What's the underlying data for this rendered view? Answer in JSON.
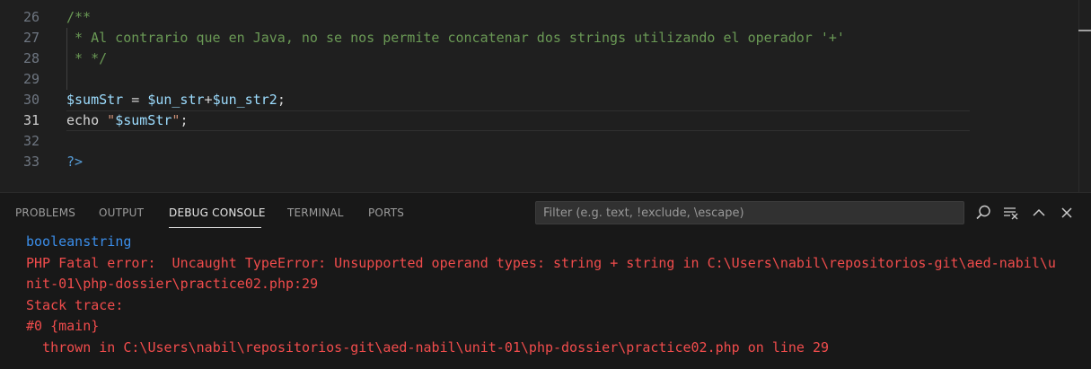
{
  "editor": {
    "lines": [
      {
        "num": "26",
        "tokens": [
          {
            "t": "/**",
            "c": "tk-comment"
          }
        ]
      },
      {
        "num": "27",
        "tokens": [
          {
            "t": " * Al contrario que en Java, no se nos permite concatenar dos strings utilizando el operador '+'",
            "c": "tk-comment"
          }
        ]
      },
      {
        "num": "28",
        "tokens": [
          {
            "t": " * */",
            "c": "tk-comment"
          }
        ]
      },
      {
        "num": "29",
        "tokens": []
      },
      {
        "num": "30",
        "tokens": [
          {
            "t": "$sumStr",
            "c": "tk-var"
          },
          {
            "t": " = ",
            "c": "tk-op"
          },
          {
            "t": "$un_str",
            "c": "tk-var"
          },
          {
            "t": "+",
            "c": "tk-op"
          },
          {
            "t": "$un_str2",
            "c": "tk-var"
          },
          {
            "t": ";",
            "c": "tk-op"
          }
        ]
      },
      {
        "num": "31",
        "active": true,
        "tokens": [
          {
            "t": "echo ",
            "c": "tk-kw"
          },
          {
            "t": "\"",
            "c": "tk-str"
          },
          {
            "t": "$sumStr",
            "c": "tk-var"
          },
          {
            "t": "\"",
            "c": "tk-str"
          },
          {
            "t": ";",
            "c": "tk-op"
          }
        ]
      },
      {
        "num": "32",
        "tokens": []
      },
      {
        "num": "33",
        "tokens": [
          {
            "t": "?>",
            "c": "tk-tag"
          }
        ]
      }
    ]
  },
  "panel": {
    "tabs": [
      {
        "label": "PROBLEMS",
        "name": "tab-problems"
      },
      {
        "label": "OUTPUT",
        "name": "tab-output"
      },
      {
        "label": "DEBUG CONSOLE",
        "name": "tab-debug-console",
        "active": true
      },
      {
        "label": "TERMINAL",
        "name": "tab-terminal"
      },
      {
        "label": "PORTS",
        "name": "tab-ports"
      }
    ],
    "filter_placeholder": "Filter (e.g. text, !exclude, \\escape)",
    "icons": [
      "search-icon",
      "clear-console-icon",
      "maximize-panel-icon",
      "close-panel-icon"
    ],
    "output": [
      {
        "text": "booleanstring",
        "kind": "info"
      },
      {
        "text": "PHP Fatal error:  Uncaught TypeError: Unsupported operand types: string + string in C:\\Users\\nabil\\repositorios-git\\aed-nabil\\u",
        "kind": "err"
      },
      {
        "text": "nit-01\\php-dossier\\practice02.php:29",
        "kind": "err"
      },
      {
        "text": "Stack trace:",
        "kind": "err"
      },
      {
        "text": "#0 {main}",
        "kind": "err"
      },
      {
        "text": "  thrown in C:\\Users\\nabil\\repositorios-git\\aed-nabil\\unit-01\\php-dossier\\practice02.php on line 29",
        "kind": "err"
      }
    ]
  }
}
